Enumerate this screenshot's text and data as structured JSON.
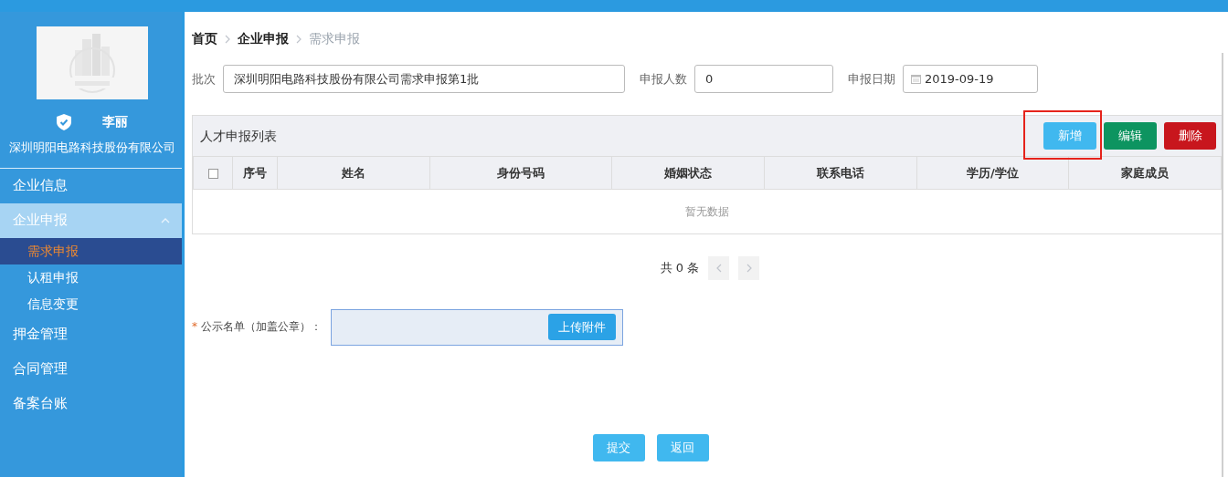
{
  "sidebar": {
    "user": {
      "name": "李丽",
      "company": "深圳明阳电路科技股份有限公司"
    },
    "items": [
      {
        "label": "企业信息",
        "expanded": false
      },
      {
        "label": "企业申报",
        "expanded": true,
        "children": [
          {
            "label": "需求申报",
            "selected": true
          },
          {
            "label": "认租申报",
            "selected": false
          },
          {
            "label": "信息变更",
            "selected": false
          }
        ]
      },
      {
        "label": "押金管理",
        "expanded": false
      },
      {
        "label": "合同管理",
        "expanded": false
      },
      {
        "label": "备案台账",
        "expanded": false
      }
    ]
  },
  "breadcrumb": [
    {
      "label": "首页",
      "current": false
    },
    {
      "label": "企业申报",
      "current": false
    },
    {
      "label": "需求申报",
      "current": true
    }
  ],
  "form": [
    {
      "label": "批次",
      "value": "深圳明阳电路科技股份有限公司需求申报第1批",
      "kind": "text"
    },
    {
      "label": "申报人数",
      "value": "0",
      "kind": "text"
    },
    {
      "label": "申报日期",
      "value": "2019-09-19",
      "kind": "date"
    }
  ],
  "table": {
    "title": "人才申报列表",
    "buttons": [
      {
        "label": "新增",
        "kind": "add",
        "highlighted": true
      },
      {
        "label": "编辑",
        "kind": "edit",
        "highlighted": false
      },
      {
        "label": "删除",
        "kind": "delete",
        "highlighted": false
      }
    ],
    "select_all": {
      "checked": false
    },
    "columns": [
      "序号",
      "姓名",
      "身份号码",
      "婚姻状态",
      "联系电话",
      "学历/学位",
      "家庭成员"
    ],
    "empty_text": "暂无数据"
  },
  "pagination": {
    "total": "共 0 条"
  },
  "upload": {
    "required": true,
    "required_mark": "*",
    "label": "公示名单（加盖公章）：",
    "button": "上传附件"
  },
  "actions": [
    "提交",
    "返回"
  ]
}
